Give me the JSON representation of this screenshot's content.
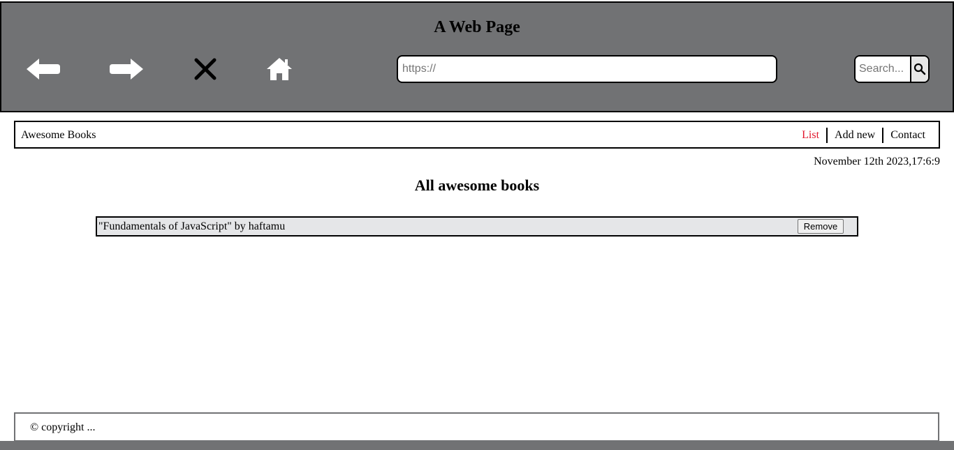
{
  "browser": {
    "title": "A Web Page",
    "url_placeholder": "https://",
    "search_placeholder": "Search...",
    "icons": [
      "arrow-left-icon",
      "arrow-right-icon",
      "close-icon",
      "home-icon",
      "search-icon"
    ]
  },
  "app": {
    "brand": "Awesome Books",
    "menu": [
      {
        "label": "List",
        "active": true
      },
      {
        "label": "Add new",
        "active": false
      },
      {
        "label": "Contact",
        "active": false
      }
    ],
    "date": "November 12th 2023,17:6:9",
    "list_title": "All awesome books",
    "books": [
      {
        "text": "\"Fundamentals of JavaScript\" by haftamu",
        "remove_label": "Remove"
      }
    ],
    "footer": "© copyright ..."
  },
  "colors": {
    "browser_bar": "#717274",
    "active_menu": "#e1162c",
    "book_row_bg": "#e5e6e8"
  }
}
